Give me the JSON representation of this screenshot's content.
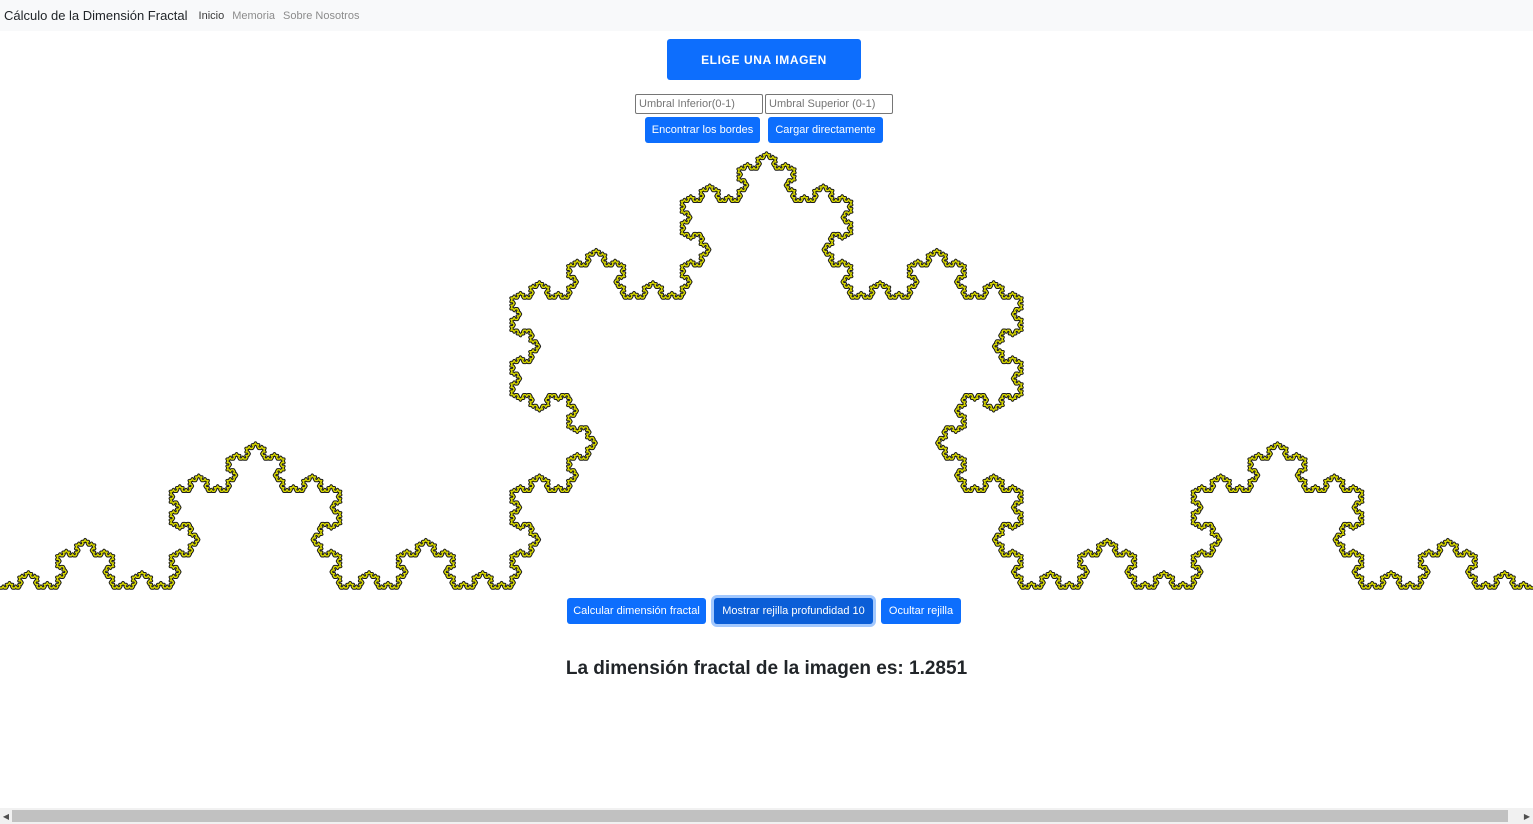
{
  "navbar": {
    "brand": "Cálculo de la Dimensión Fractal",
    "links": [
      "Inicio",
      "Memoria",
      "Sobre Nosotros"
    ]
  },
  "upload": {
    "choose_image_label": "ELIGE UNA IMAGEN"
  },
  "thresholds": {
    "lower_placeholder": "Umbral Inferior(0-1)",
    "lower_value": "",
    "upper_placeholder": "Umbral Superior (0-1)",
    "upper_value": ""
  },
  "actions": {
    "find_edges_label": "Encontrar los bordes",
    "load_direct_label": "Cargar directamente"
  },
  "analysis": {
    "calc_label": "Calcular dimensión fractal",
    "show_grid_label": "Mostrar rejilla profundidad 10",
    "hide_grid_label": "Ocultar rejilla"
  },
  "result": {
    "text": "La dimensión fractal de la imagen es: 1.2851"
  },
  "colors": {
    "primary": "#0d6efd",
    "fractal_line": "#d8d800",
    "fractal_outline": "#1a1a1a",
    "navbar_bg": "#f8f9fa"
  },
  "icons": {
    "scroll_left": "◀",
    "scroll_right": "▶"
  }
}
